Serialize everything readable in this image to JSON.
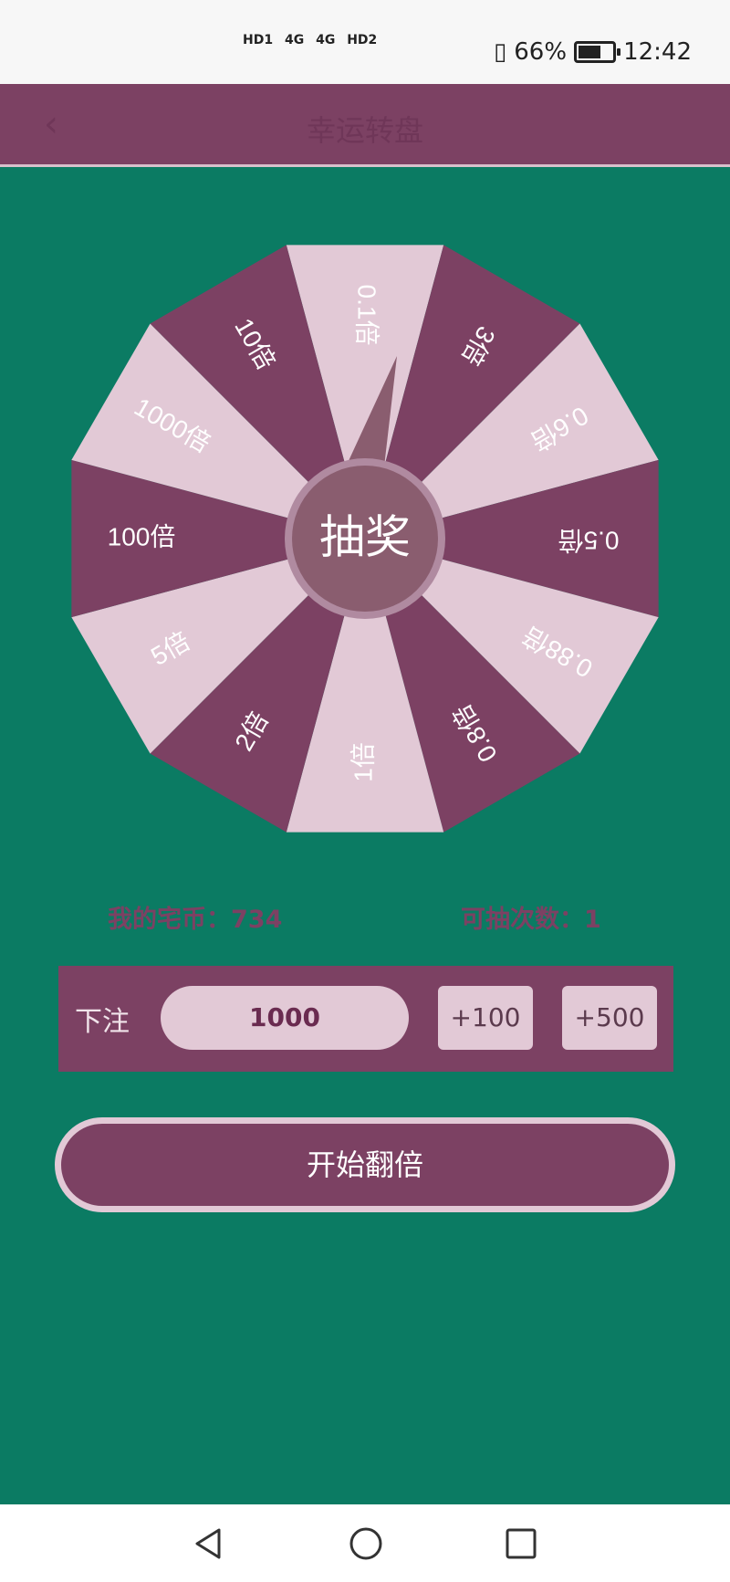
{
  "status_bar": {
    "net_labels": [
      "HD1",
      "4G",
      "4G",
      "HD2"
    ],
    "battery_percent": "66%",
    "time": "12:42"
  },
  "header": {
    "title": "幸运转盘"
  },
  "wheel": {
    "segments": [
      "0.1倍",
      "3倍",
      "0.6倍",
      "0.5倍",
      "0.88倍",
      "0.8倍",
      "1倍",
      "2倍",
      "5倍",
      "100倍",
      "1000倍",
      "10倍"
    ],
    "center_label": "抽奖",
    "colors": {
      "dark": "#7c4163",
      "light": "#e2c9d6",
      "center": "#8a5d6f",
      "center_ring": "#b08aa0"
    }
  },
  "stats": {
    "coins_label": "我的宅币：734",
    "draws_label": "可抽次数：1"
  },
  "bet": {
    "label": "下注",
    "amount": "1000",
    "plus100": "+100",
    "plus500": "+500"
  },
  "start_button": "开始翻倍"
}
